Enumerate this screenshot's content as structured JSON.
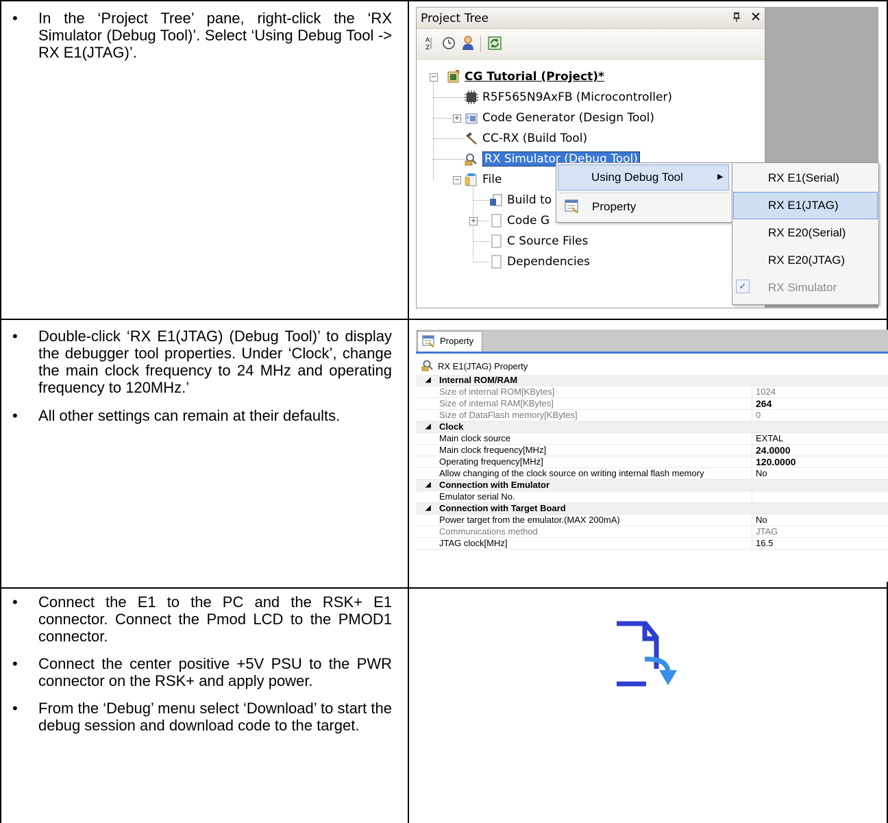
{
  "rows": [
    {
      "bullets": [
        "In the ‘Project Tree’ pane, right-click the ‘RX Simulator (Debug Tool)’.   Select ‘Using Debug Tool -> RX E1(JTAG)’."
      ]
    },
    {
      "bullets": [
        "Double-click ‘RX E1(JTAG) (Debug Tool)’ to display the debugger tool properties. Under ‘Clock’, change the main clock frequency to 24 MHz and operating frequency to 120MHz.’",
        "All other settings can remain at their defaults."
      ]
    },
    {
      "bullets": [
        "Connect the E1 to the PC and the RSK+ E1 connector.  Connect the Pmod LCD to the PMOD1 connector.",
        "Connect the center positive +5V PSU to the PWR connector on the RSK+ and apply power.",
        "From the ‘Debug’ menu select ‘Download’ to start the debug session and download code to the target."
      ]
    }
  ],
  "project_tree": {
    "title": "Project Tree",
    "pin": "ᵖ",
    "close": "✕",
    "items": [
      "CG Tutorial (Project)*",
      "R5F565N9AxFB (Microcontroller)",
      "Code Generator (Design Tool)",
      "CC-RX (Build Tool)",
      "RX Simulator (Debug Tool)",
      "File",
      "Build to",
      "Code G",
      "C Source Files",
      "Dependencies"
    ],
    "context_menu": {
      "using_debug_tool": "Using Debug Tool",
      "property": "Property"
    },
    "submenu": [
      "RX E1(Serial)",
      "RX E1(JTAG)",
      "RX E20(Serial)",
      "RX E20(JTAG)",
      "RX Simulator"
    ],
    "submenu_selected_index": 1,
    "submenu_checked_index": 4
  },
  "property": {
    "tab": "Property",
    "header": "RX E1(JTAG) Property",
    "rows": [
      {
        "type": "cat",
        "k": "Internal ROM/RAM"
      },
      {
        "type": "row",
        "k": "Size of internal ROM[KBytes]",
        "v": "1024",
        "style": "gray"
      },
      {
        "type": "row",
        "k": "Size of internal RAM[KBytes]",
        "v": "264",
        "style": "gray-boldv"
      },
      {
        "type": "row",
        "k": "Size of DataFlash memory[KBytes]",
        "v": "0",
        "style": "gray"
      },
      {
        "type": "cat",
        "k": "Clock"
      },
      {
        "type": "row",
        "k": "Main clock source",
        "v": "EXTAL",
        "style": ""
      },
      {
        "type": "row",
        "k": "Main clock frequency[MHz]",
        "v": "24.0000",
        "style": "boldv"
      },
      {
        "type": "row",
        "k": "Operating frequency[MHz]",
        "v": "120.0000",
        "style": "boldv"
      },
      {
        "type": "row",
        "k": "Allow changing of the clock source on writing internal flash memory",
        "v": "No",
        "style": ""
      },
      {
        "type": "cat",
        "k": "Connection with Emulator"
      },
      {
        "type": "row",
        "k": "Emulator serial No.",
        "v": "",
        "style": ""
      },
      {
        "type": "cat",
        "k": "Connection with Target Board"
      },
      {
        "type": "row",
        "k": "Power target from the emulator.(MAX 200mA)",
        "v": "No",
        "style": ""
      },
      {
        "type": "row",
        "k": "Communications method",
        "v": "JTAG",
        "style": "gray"
      },
      {
        "type": "row",
        "k": "JTAG clock[MHz]",
        "v": "16.5",
        "style": ""
      }
    ]
  },
  "colors": {
    "download_icon": "#2d3fcf",
    "download_arrow": "#3a8fe8"
  }
}
